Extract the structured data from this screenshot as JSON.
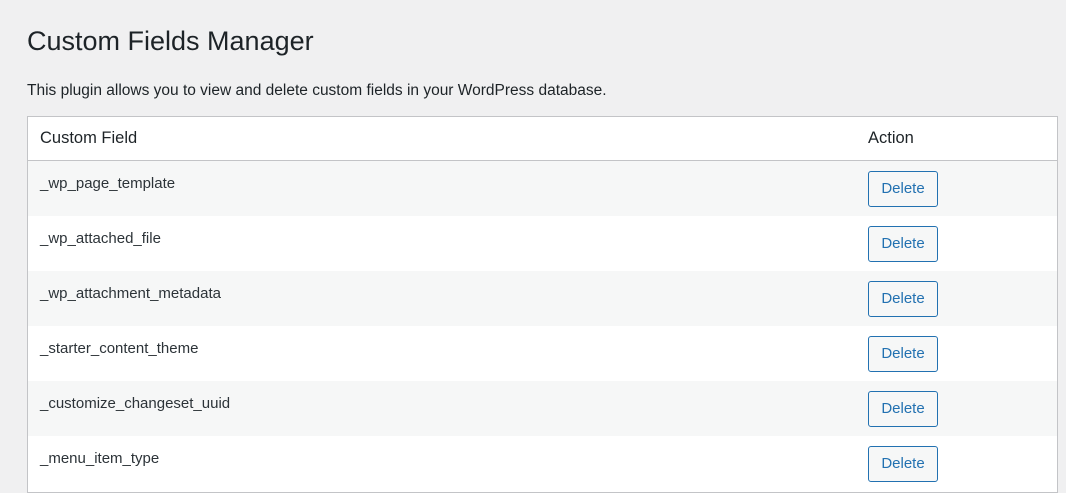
{
  "page": {
    "title": "Custom Fields Manager",
    "description": "This plugin allows you to view and delete custom fields in your WordPress database."
  },
  "table": {
    "headers": {
      "field": "Custom Field",
      "action": "Action"
    },
    "rows": [
      {
        "field": "_wp_page_template",
        "action_label": "Delete"
      },
      {
        "field": "_wp_attached_file",
        "action_label": "Delete"
      },
      {
        "field": "_wp_attachment_metadata",
        "action_label": "Delete"
      },
      {
        "field": "_starter_content_theme",
        "action_label": "Delete"
      },
      {
        "field": "_customize_changeset_uuid",
        "action_label": "Delete"
      },
      {
        "field": "_menu_item_type",
        "action_label": "Delete"
      }
    ]
  },
  "colors": {
    "background": "#f0f0f1",
    "button_accent": "#2271b1",
    "border": "#c3c4c7"
  }
}
